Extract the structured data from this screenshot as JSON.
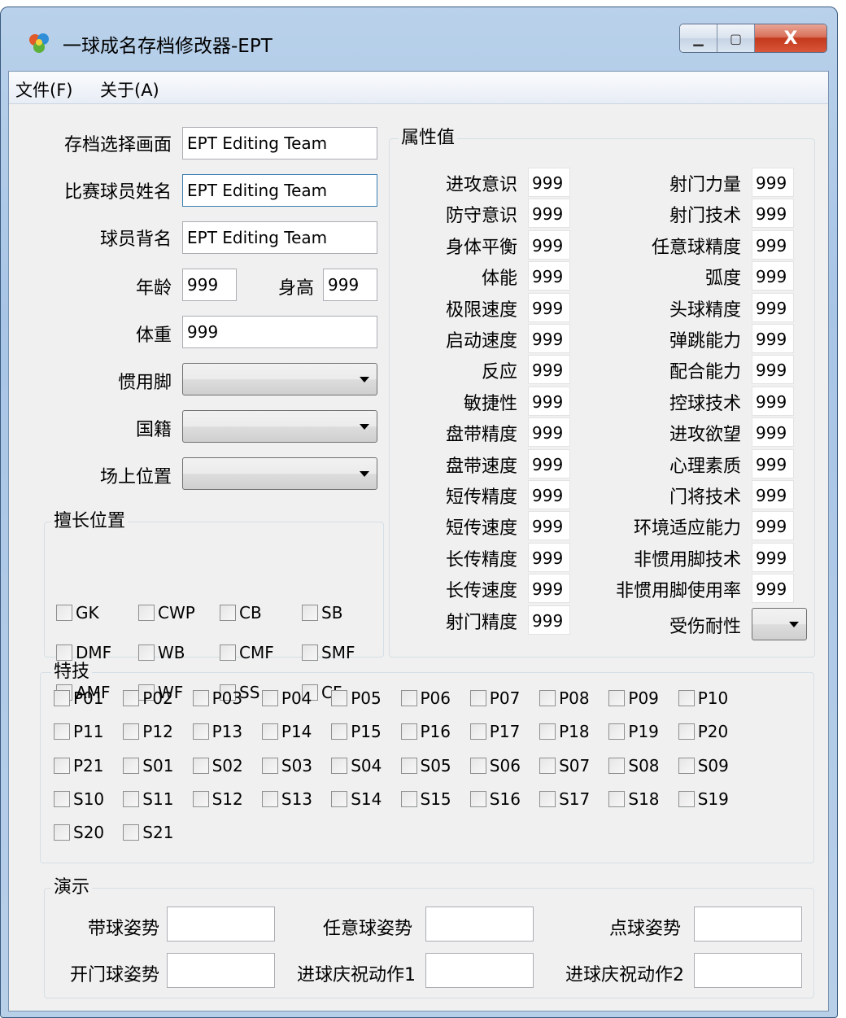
{
  "window": {
    "title": "一球成名存档修改器-EPT",
    "minimize": "▁",
    "maximize": "▢",
    "close": "X"
  },
  "menu": [
    "文件(F)",
    "关于(A)"
  ],
  "left": {
    "save_screen_label": "存档选择画面",
    "save_screen_value": "EPT Editing Team",
    "match_name_label": "比赛球员姓名",
    "match_name_value": "EPT Editing Team",
    "back_name_label": "球员背名",
    "back_name_value": "EPT Editing Team",
    "age_label": "年龄",
    "age_value": "999",
    "height_label": "身高",
    "height_value": "999",
    "weight_label": "体重",
    "weight_value": "999",
    "foot_label": "惯用脚",
    "nation_label": "国籍",
    "position_label": "场上位置"
  },
  "positions": {
    "title": "擅长位置",
    "items": [
      "GK",
      "CWP",
      "CB",
      "SB",
      "DMF",
      "WB",
      "CMF",
      "SMF",
      "AMF",
      "WF",
      "SS",
      "CF"
    ]
  },
  "attributes": {
    "title": "属性值",
    "left": [
      {
        "label": "进攻意识",
        "value": "999"
      },
      {
        "label": "防守意识",
        "value": "999"
      },
      {
        "label": "身体平衡",
        "value": "999"
      },
      {
        "label": "体能",
        "value": "999"
      },
      {
        "label": "极限速度",
        "value": "999"
      },
      {
        "label": "启动速度",
        "value": "999"
      },
      {
        "label": "反应",
        "value": "999"
      },
      {
        "label": "敏捷性",
        "value": "999"
      },
      {
        "label": "盘带精度",
        "value": "999"
      },
      {
        "label": "盘带速度",
        "value": "999"
      },
      {
        "label": "短传精度",
        "value": "999"
      },
      {
        "label": "短传速度",
        "value": "999"
      },
      {
        "label": "长传精度",
        "value": "999"
      },
      {
        "label": "长传速度",
        "value": "999"
      },
      {
        "label": "射门精度",
        "value": "999"
      }
    ],
    "right": [
      {
        "label": "射门力量",
        "value": "999"
      },
      {
        "label": "射门技术",
        "value": "999"
      },
      {
        "label": "任意球精度",
        "value": "999"
      },
      {
        "label": "弧度",
        "value": "999"
      },
      {
        "label": "头球精度",
        "value": "999"
      },
      {
        "label": "弹跳能力",
        "value": "999"
      },
      {
        "label": "配合能力",
        "value": "999"
      },
      {
        "label": "控球技术",
        "value": "999"
      },
      {
        "label": "进攻欲望",
        "value": "999"
      },
      {
        "label": "心理素质",
        "value": "999"
      },
      {
        "label": "门将技术",
        "value": "999"
      },
      {
        "label": "环境适应能力",
        "value": "999"
      },
      {
        "label": "非惯用脚技术",
        "value": "999"
      },
      {
        "label": "非惯用脚使用率",
        "value": "999"
      }
    ],
    "injury_label": "受伤耐性"
  },
  "skills": {
    "title": "特技",
    "items": [
      "P01",
      "P02",
      "P03",
      "P04",
      "P05",
      "P06",
      "P07",
      "P08",
      "P09",
      "P10",
      "P11",
      "P12",
      "P13",
      "P14",
      "P15",
      "P16",
      "P17",
      "P18",
      "P19",
      "P20",
      "P21",
      "S01",
      "S02",
      "S03",
      "S04",
      "S05",
      "S06",
      "S07",
      "S08",
      "S09",
      "S10",
      "S11",
      "S12",
      "S13",
      "S14",
      "S15",
      "S16",
      "S17",
      "S18",
      "S19",
      "S20",
      "S21"
    ]
  },
  "demo": {
    "title": "演示",
    "fields": [
      {
        "label": "带球姿势",
        "value": ""
      },
      {
        "label": "任意球姿势",
        "value": ""
      },
      {
        "label": "点球姿势",
        "value": ""
      },
      {
        "label": "开门球姿势",
        "value": ""
      },
      {
        "label": "进球庆祝动作1",
        "value": ""
      },
      {
        "label": "进球庆祝动作2",
        "value": ""
      }
    ]
  }
}
